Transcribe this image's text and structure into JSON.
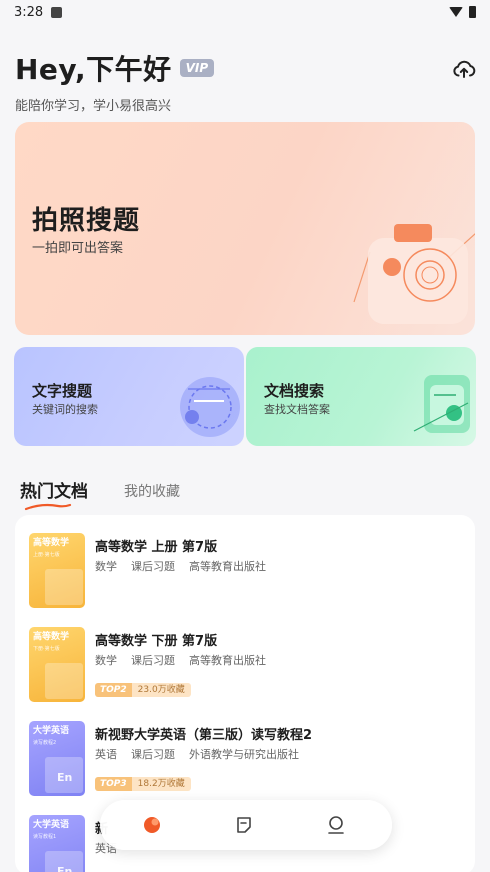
{
  "status_bar": {
    "time": "3:28"
  },
  "header": {
    "greeting": "Hey,下午好",
    "vip_badge": "VIP",
    "subtitle": "能陪你学习，学小易很高兴"
  },
  "photo_search": {
    "title": "拍照搜题",
    "description": "一拍即可出答案"
  },
  "text_search": {
    "title": "文字搜题",
    "description": "关键词的搜索"
  },
  "doc_search": {
    "title": "文档搜索",
    "description": "查找文档答案"
  },
  "tabs": [
    {
      "label": "热门文档",
      "active": true
    },
    {
      "label": "我的收藏",
      "active": false
    }
  ],
  "documents": [
    {
      "cover_title": "高等数学",
      "cover_sub": "上册·第七版",
      "cover_color": "yellow",
      "name": "高等数学 上册 第7版",
      "tags": [
        "数学",
        "课后习题",
        "高等教育出版社"
      ]
    },
    {
      "cover_title": "高等数学",
      "cover_sub": "下册·第七版",
      "cover_color": "yellow",
      "name": "高等数学 下册 第7版",
      "tags": [
        "数学",
        "课后习题",
        "高等教育出版社"
      ],
      "rank": "TOP2",
      "favorites": "23.0万收藏"
    },
    {
      "cover_title": "大学英语",
      "cover_sub": "读写教程2",
      "cover_color": "purple",
      "name": "新视野大学英语（第三版）读写教程2",
      "tags": [
        "英语",
        "课后习题",
        "外语教学与研究出版社"
      ],
      "rank": "TOP3",
      "favorites": "18.2万收藏"
    },
    {
      "cover_title": "大学英语",
      "cover_sub": "读写教程1",
      "cover_color": "purple",
      "name": "新",
      "tags": [
        "英语"
      ]
    }
  ],
  "colors": {
    "photo_card": "#fcd5c6",
    "text_card": "#c1caff",
    "doc_card": "#b3f3d2",
    "accent": "#f05a28",
    "vip_badge": "#aab0c4"
  },
  "icons": [
    "cloud-upload-icon",
    "home-icon",
    "note-icon",
    "profile-icon"
  ]
}
